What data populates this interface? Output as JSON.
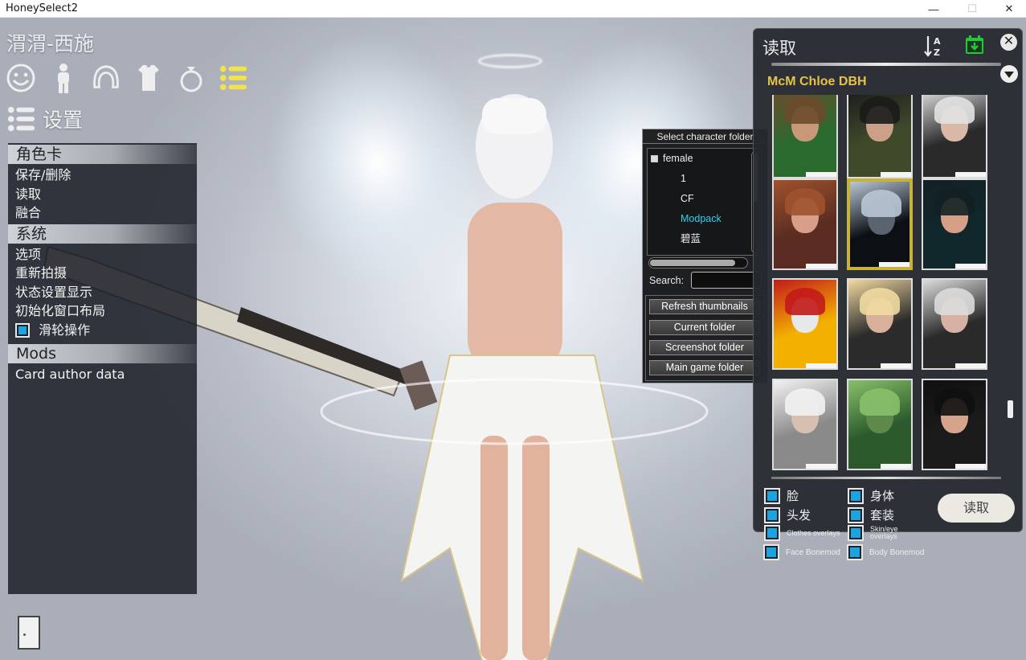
{
  "window": {
    "title": "HoneySelect2",
    "minimize_glyph": "—",
    "maximize_glyph": "☐",
    "close_glyph": "✕"
  },
  "character": {
    "name": "渭渭-西施"
  },
  "category_icons": [
    "face-icon",
    "body-icon",
    "hair-icon",
    "clothes-icon",
    "accessory-ring-icon",
    "system-menu-icon"
  ],
  "settings": {
    "label": "设置",
    "sections": [
      {
        "header": "角色卡",
        "items": [
          "保存/删除",
          "读取",
          "融合"
        ]
      },
      {
        "header": "系统",
        "items": [
          "选项",
          "重新拍摄",
          "状态设置显示",
          "初始化窗口布局"
        ],
        "toggle": {
          "label": "滑轮操作",
          "checked": true
        }
      },
      {
        "header": "Mods",
        "items": [
          "Card author data"
        ]
      }
    ]
  },
  "folder_popup": {
    "title": "Select character folder",
    "tree": [
      {
        "label": "female",
        "indent": 0,
        "selected": false,
        "expand": true
      },
      {
        "label": "1",
        "indent": 1,
        "selected": false
      },
      {
        "label": "CF",
        "indent": 1,
        "selected": false
      },
      {
        "label": "Modpack",
        "indent": 1,
        "selected": true
      },
      {
        "label": "碧蓝",
        "indent": 1,
        "selected": false
      }
    ],
    "search_label": "Search:",
    "search_value": "",
    "buttons": [
      "Refresh thumbnails",
      "Current folder",
      "Screenshot folder",
      "Main game folder"
    ]
  },
  "load_panel": {
    "title": "读取",
    "folder_name": "McM Chloe DBH",
    "sort_icon": "sort-az-icon",
    "date_icon": "calendar-download-icon",
    "close_glyph": "✕",
    "thumbnails": [
      {
        "palette": [
          "#2a6a2f",
          "#6d4a2c",
          "#c89978"
        ],
        "selected": false
      },
      {
        "palette": [
          "#3f4a2b",
          "#1b1b1b",
          "#caa088"
        ],
        "selected": false
      },
      {
        "palette": [
          "#2a2a2a",
          "#e2e2e2",
          "#d9b8a8"
        ],
        "selected": false
      },
      {
        "palette": [
          "#5b2d22",
          "#a0522d",
          "#d79f8a"
        ],
        "selected": false
      },
      {
        "palette": [
          "#0c1014",
          "#b9c8d6",
          "#5a6470"
        ],
        "selected": true
      },
      {
        "palette": [
          "#10282c",
          "#132024",
          "#d6a088"
        ],
        "selected": false
      },
      {
        "palette": [
          "#f2b000",
          "#c21a1a",
          "#e8e8e8"
        ],
        "selected": false
      },
      {
        "palette": [
          "#2b2b2b",
          "#f1d9a0",
          "#d9b09a"
        ],
        "selected": false
      },
      {
        "palette": [
          "#2a2a2a",
          "#dcdcdc",
          "#d7b2a4"
        ],
        "selected": false
      },
      {
        "palette": [
          "#8a8a8a",
          "#f2f2f2",
          "#d8c0b0"
        ],
        "selected": false
      },
      {
        "palette": [
          "#2c5a2c",
          "#88c06a",
          "#5d8a4a"
        ],
        "selected": false
      },
      {
        "palette": [
          "#1b1b1b",
          "#101010",
          "#d5a48c"
        ],
        "selected": false
      }
    ],
    "options": [
      {
        "label": "脸",
        "checked": true,
        "size": "big"
      },
      {
        "label": "身体",
        "checked": true,
        "size": "big"
      },
      {
        "label": "头发",
        "checked": true,
        "size": "big"
      },
      {
        "label": "套装",
        "checked": true,
        "size": "big"
      },
      {
        "label": "Clothes overlays",
        "checked": true,
        "size": "small"
      },
      {
        "label": "Skin/eye overlays",
        "checked": true,
        "size": "small"
      }
    ],
    "extra_options": [
      {
        "label": "Face Bonemod",
        "checked": true
      },
      {
        "label": "Body Bonemod",
        "checked": true
      }
    ],
    "load_button": "读取"
  },
  "colors": {
    "accent_blue": "#1aa4e0",
    "folder_gold": "#e6c248",
    "selected_folder": "#33d0f0",
    "date_icon_green": "#22c93a"
  },
  "exit_icon": "door-exit-icon"
}
